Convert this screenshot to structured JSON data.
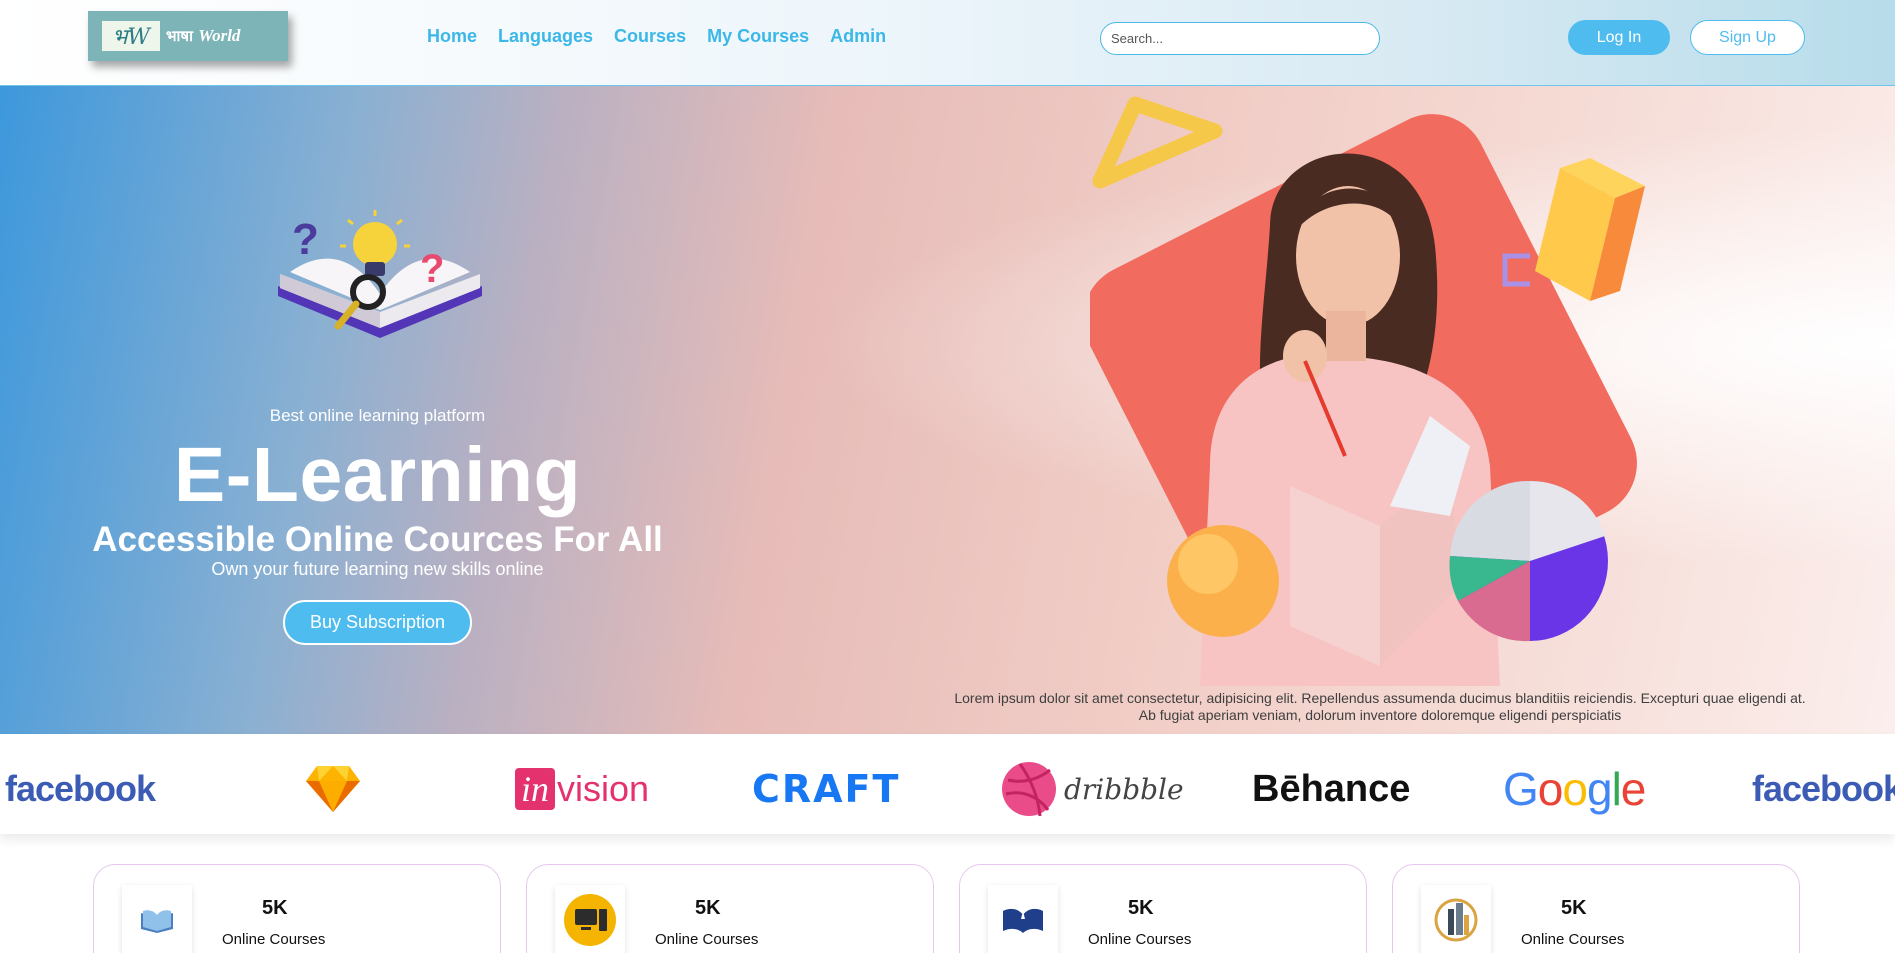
{
  "brand": {
    "logo_mark": "भW",
    "logo_text": "भाषा",
    "logo_suffix": "World"
  },
  "nav": {
    "items": [
      {
        "label": "Home"
      },
      {
        "label": "Languages"
      },
      {
        "label": "Courses"
      },
      {
        "label": "My Courses"
      },
      {
        "label": "Admin"
      }
    ]
  },
  "search": {
    "placeholder": "Search..."
  },
  "auth": {
    "login_label": "Log In",
    "signup_label": "Sign Up"
  },
  "hero": {
    "eyebrow": "Best online learning platform",
    "title": "E-Learning",
    "subtitle": "Accessible Online Cources For All",
    "tagline": "Own your future learning new skills online",
    "cta_label": "Buy Subscription",
    "lorem_line1": "Lorem ipsum dolor sit amet consectetur, adipisicing elit. Repellendus assumenda ducimus blanditiis reiciendis. Excepturi quae eligendi at.",
    "lorem_line2": "Ab fugiat aperiam veniam, dolorum inventore doloremque eligendi perspiciatis"
  },
  "brands": [
    {
      "name": "facebook",
      "icon": "facebook-logo"
    },
    {
      "name": "sketch",
      "icon": "sketch-diamond-logo"
    },
    {
      "name": "in",
      "suffix": "vision",
      "icon": "invision-logo"
    },
    {
      "name": "CRAFT",
      "icon": "craft-logo"
    },
    {
      "name": "dribbble",
      "icon": "dribbble-logo"
    },
    {
      "name": "Bēhance",
      "icon": "behance-logo"
    },
    {
      "name": "Google",
      "icon": "google-logo"
    },
    {
      "name": "facebook",
      "icon": "facebook-logo"
    }
  ],
  "stats": [
    {
      "value": "5K",
      "label": "Online Courses",
      "icon": "book-icon"
    },
    {
      "value": "5K",
      "label": "Online Courses",
      "icon": "computer-icon"
    },
    {
      "value": "5K",
      "label": "Online Courses",
      "icon": "open-book-icon"
    },
    {
      "value": "5K",
      "label": "Online Courses",
      "icon": "building-icon"
    }
  ],
  "colors": {
    "accent": "#4fbcef",
    "nav_link": "#3bb7e8",
    "logo_bg": "#7cb4b8",
    "hero_left": "#3d98dc",
    "hero_right": "#fbeeec",
    "blob": "#f26b5f"
  }
}
